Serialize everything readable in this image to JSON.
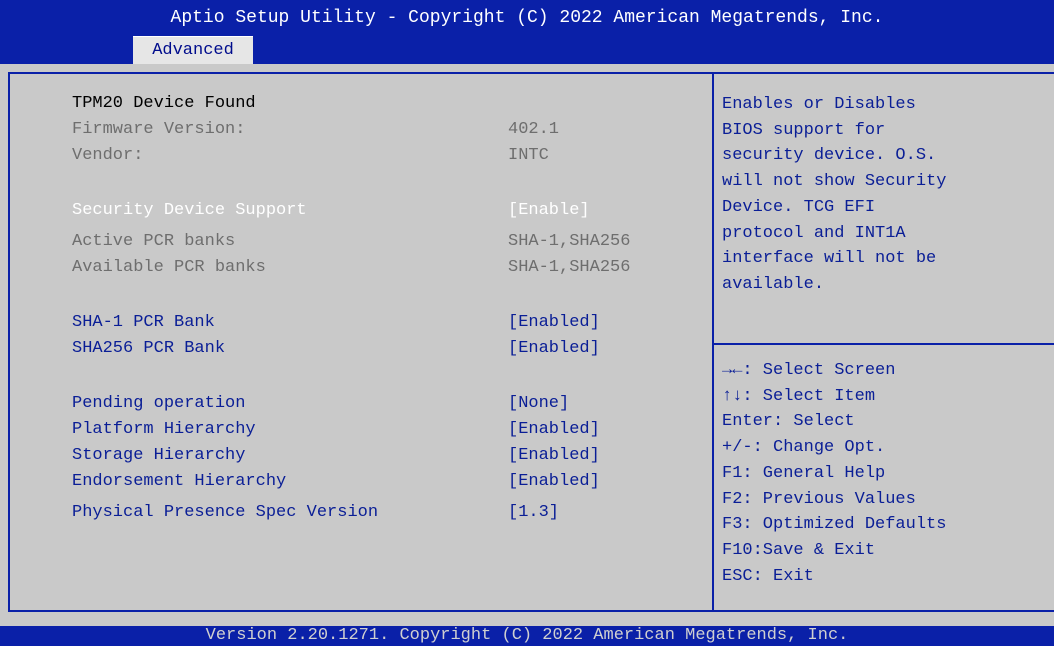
{
  "header": {
    "title": "Aptio Setup Utility - Copyright (C) 2022 American Megatrends, Inc.",
    "tab": "Advanced"
  },
  "settings": {
    "device_found": "TPM20 Device Found",
    "firmware_label": "Firmware Version:",
    "firmware_value": "402.1",
    "vendor_label": "Vendor:",
    "vendor_value": "INTC",
    "security_label": "Security Device Support",
    "security_value": "[Enable]",
    "active_pcr_label": "Active PCR banks",
    "active_pcr_value": "SHA-1,SHA256",
    "available_pcr_label": "Available PCR banks",
    "available_pcr_value": "SHA-1,SHA256",
    "sha1_label": "SHA-1 PCR Bank",
    "sha1_value": "[Enabled]",
    "sha256_label": "SHA256 PCR Bank",
    "sha256_value": "[Enabled]",
    "pending_label": "Pending operation",
    "pending_value": "[None]",
    "platform_label": "Platform Hierarchy",
    "platform_value": "[Enabled]",
    "storage_label": "Storage Hierarchy",
    "storage_value": "[Enabled]",
    "endorsement_label": "Endorsement Hierarchy",
    "endorsement_value": "[Enabled]",
    "ppspec_label": "Physical Presence Spec Version",
    "ppspec_value": "[1.3]"
  },
  "help": {
    "description": "Enables or Disables\nBIOS support for\nsecurity device. O.S.\nwill not show Security\nDevice. TCG EFI\nprotocol and INT1A\ninterface will not be\navailable.",
    "keys": "→←: Select Screen\n↑↓: Select Item\nEnter: Select\n+/-: Change Opt.\nF1: General Help\nF2: Previous Values\nF3: Optimized Defaults\nF10:Save & Exit\nESC: Exit"
  },
  "footer": {
    "text": "Version 2.20.1271. Copyright (C) 2022 American Megatrends, Inc."
  }
}
